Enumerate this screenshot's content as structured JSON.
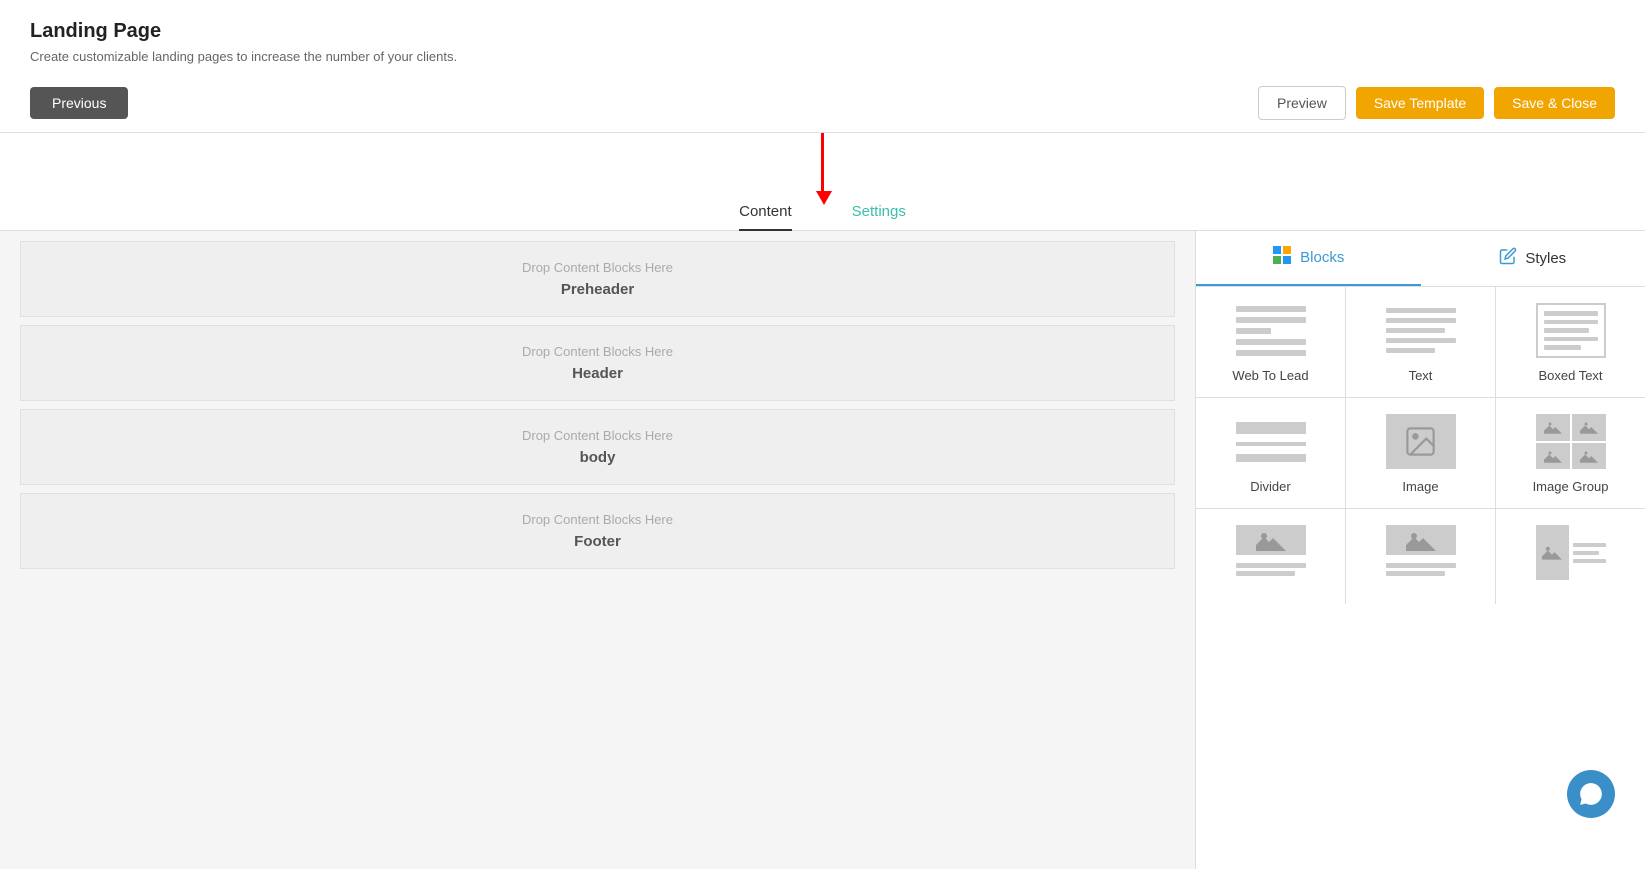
{
  "page": {
    "title": "Landing Page",
    "subtitle": "Create customizable landing pages to increase the number of your clients."
  },
  "toolbar": {
    "previous_label": "Previous",
    "preview_label": "Preview",
    "save_template_label": "Save Template",
    "save_close_label": "Save & Close"
  },
  "tabs": [
    {
      "id": "content",
      "label": "Content",
      "active": true
    },
    {
      "id": "settings",
      "label": "Settings",
      "active": false
    }
  ],
  "canvas": {
    "sections": [
      {
        "drop_label": "Drop Content Blocks Here",
        "section_name": "Preheader"
      },
      {
        "drop_label": "Drop Content Blocks Here",
        "section_name": "Header"
      },
      {
        "drop_label": "Drop Content Blocks Here",
        "section_name": "body"
      },
      {
        "drop_label": "Drop Content Blocks Here",
        "section_name": "Footer"
      }
    ]
  },
  "blocks_panel": {
    "tabs": [
      {
        "id": "blocks",
        "label": "Blocks",
        "active": true
      },
      {
        "id": "styles",
        "label": "Styles",
        "active": false
      }
    ],
    "blocks": [
      {
        "id": "web-to-lead",
        "label": "Web To Lead"
      },
      {
        "id": "text",
        "label": "Text"
      },
      {
        "id": "boxed-text",
        "label": "Boxed Text"
      },
      {
        "id": "divider",
        "label": "Divider"
      },
      {
        "id": "image",
        "label": "Image"
      },
      {
        "id": "image-group",
        "label": "Image Group"
      },
      {
        "id": "image-text-1",
        "label": ""
      },
      {
        "id": "image-text-2",
        "label": ""
      },
      {
        "id": "image-text-3",
        "label": ""
      }
    ]
  }
}
